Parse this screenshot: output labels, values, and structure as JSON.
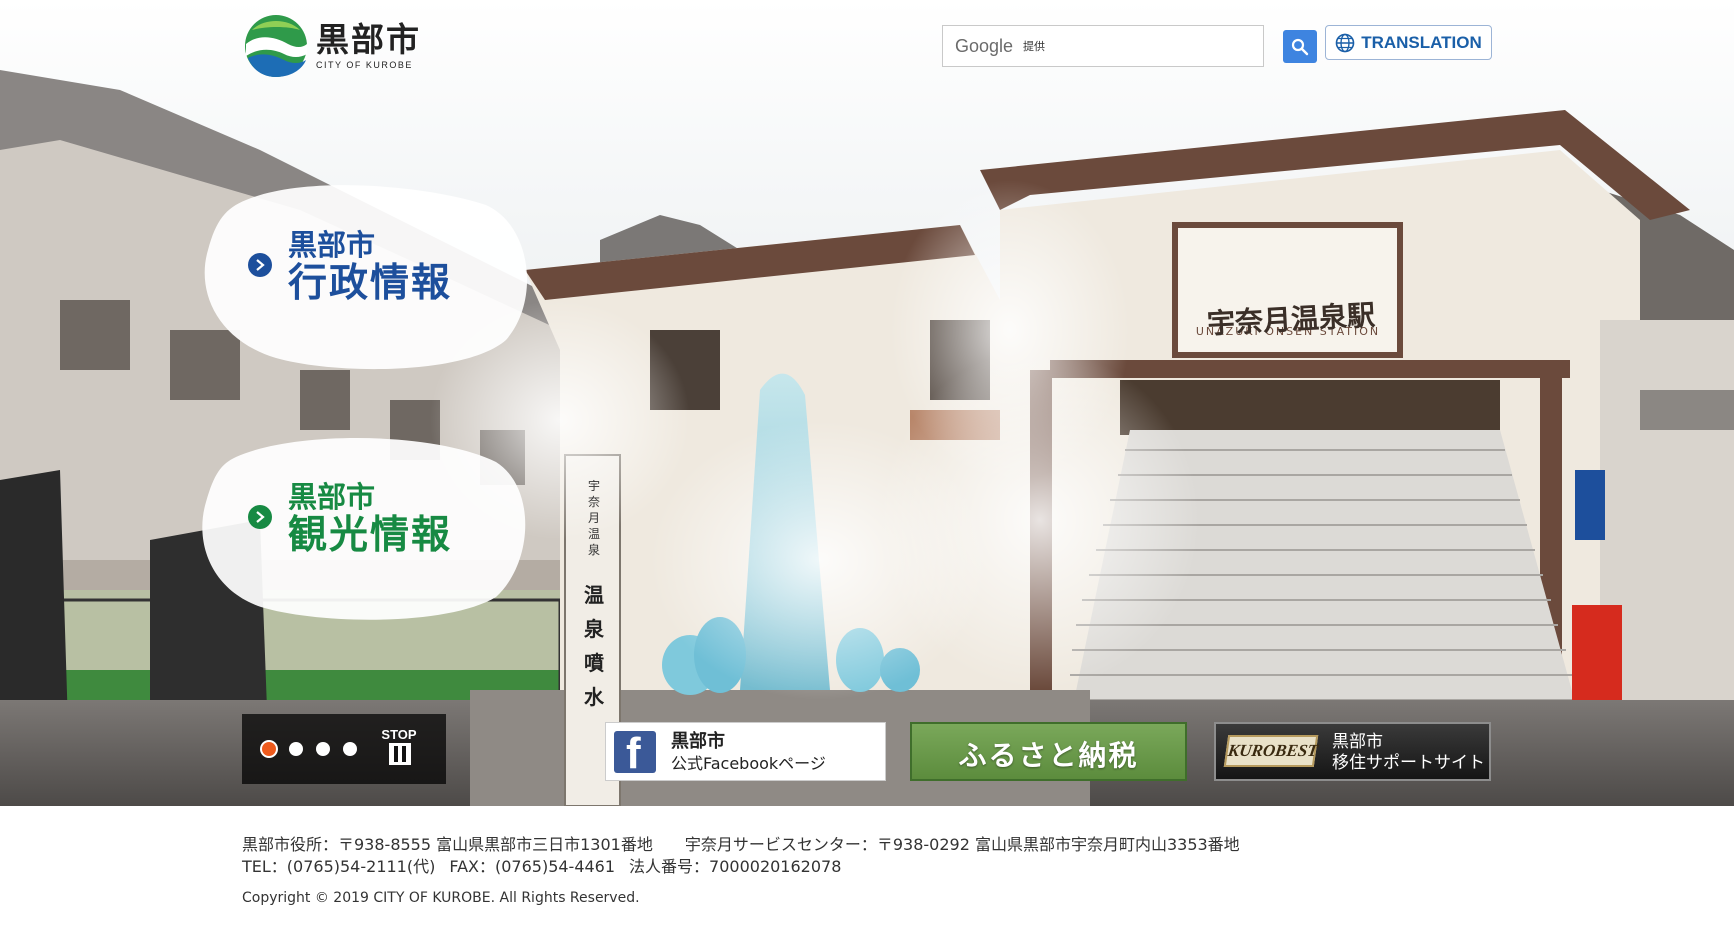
{
  "header": {
    "logo_name": "黒部市",
    "logo_sub": "CITY OF KUROBE",
    "search_brand": "Google",
    "search_provided": "提供",
    "translation_label": "TRANSLATION"
  },
  "hero": {
    "station_sign": "宇奈月温泉駅",
    "station_sign_en": "UNAZUKI ONSEN STATION",
    "monument_small": "宇奈月温泉",
    "monument_large": "温泉噴水"
  },
  "categories": [
    {
      "line1": "黒部市",
      "line2": "行政情報",
      "color": "#1d4f9c"
    },
    {
      "line1": "黒部市",
      "line2": "観光情報",
      "color": "#178a43"
    }
  ],
  "slider": {
    "dots": 4,
    "active_index": 0,
    "stop_label": "STOP"
  },
  "banners": {
    "facebook": {
      "line1": "黒部市",
      "line2": "公式Facebookページ"
    },
    "furusato": {
      "label": "ふるさと納税"
    },
    "kurobest": {
      "logo": "KUROBEST",
      "line1": "黒部市",
      "line2": "移住サポートサイト"
    }
  },
  "footer": {
    "office": "黒部市役所：〒938-8555 富山県黒部市三日市1301番地",
    "service_center": "宇奈月サービスセンター：〒938-0292 富山県黒部市宇奈月町内山3353番地",
    "tel": "TEL：(0765)54-2111(代)",
    "fax": "FAX：(0765)54-4461",
    "corp_no": "法人番号：7000020162078",
    "copyright": "Copyright © 2019 CITY OF KUROBE. All Rights Reserved."
  },
  "colors": {
    "accent_blue": "#3e84e0",
    "admin_blue": "#1d4f9c",
    "tourism_green": "#178a43",
    "active_dot": "#ee5a1c"
  }
}
